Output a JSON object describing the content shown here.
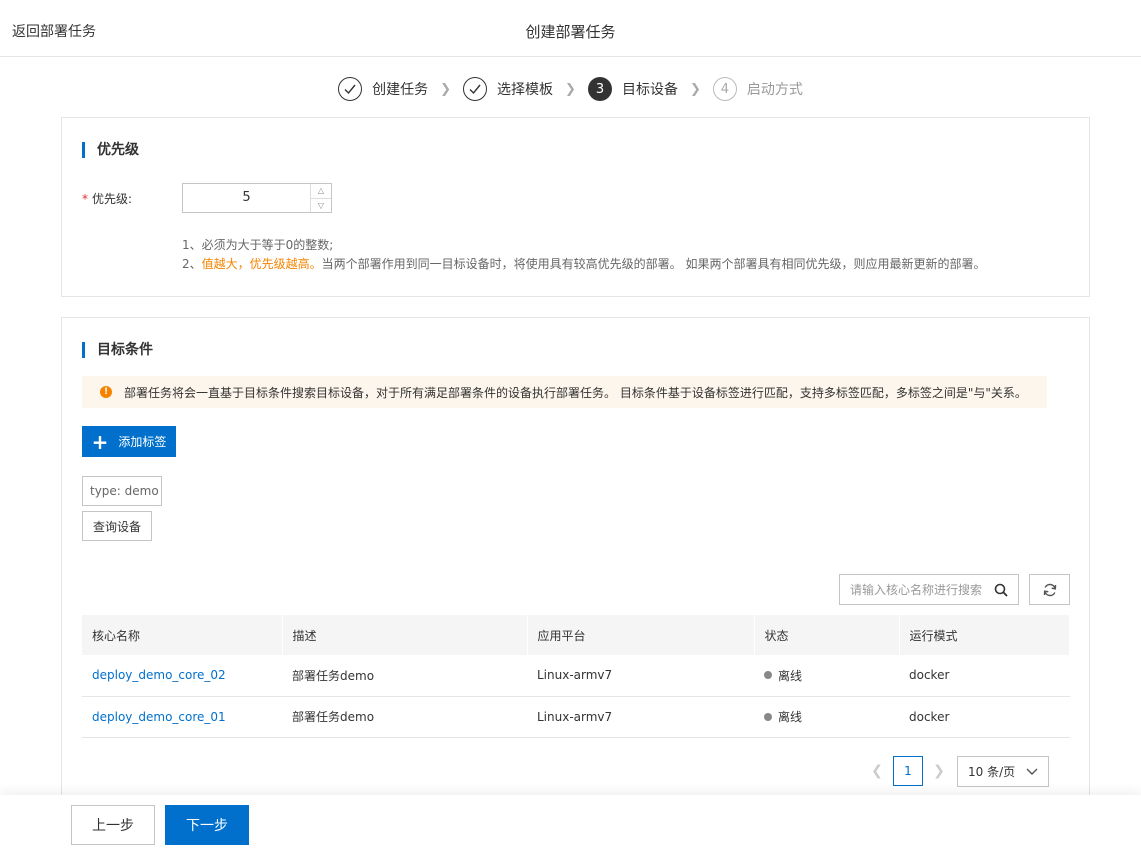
{
  "header": {
    "back_label": "返回部署任务",
    "title": "创建部署任务"
  },
  "steps": [
    {
      "label": "创建任务",
      "state": "done"
    },
    {
      "label": "选择模板",
      "state": "done"
    },
    {
      "label": "目标设备",
      "state": "active",
      "number": "3"
    },
    {
      "label": "启动方式",
      "state": "pending",
      "number": "4"
    }
  ],
  "priority": {
    "section_title": "优先级",
    "field_label": "优先级:",
    "required_mark": "*",
    "value": "5",
    "note1": "1、必须为大于等于0的整数;",
    "note2_prefix": "2、",
    "note2_highlight": "值越大，优先级越高。",
    "note2_rest": "当两个部署作用到同一目标设备时，将使用具有较高优先级的部署。 如果两个部署具有相同优先级，则应用最新更新的部署。"
  },
  "target": {
    "section_title": "目标条件",
    "alert_text": "部署任务将会一直基于目标条件搜索目标设备，对于所有满足部署条件的设备执行部署任务。 目标条件基于设备标签进行匹配，支持多标签匹配，多标签之间是\"与\"关系。",
    "add_tag_label": "添加标签",
    "tag_value": "type: demo",
    "query_label": "查询设备",
    "search_placeholder": "请输入核心名称进行搜索",
    "columns": [
      "核心名称",
      "描述",
      "应用平台",
      "状态",
      "运行模式"
    ],
    "rows": [
      {
        "name": "deploy_demo_core_02",
        "desc": "部署任务demo",
        "platform": "Linux-armv7",
        "status": "离线",
        "mode": "docker"
      },
      {
        "name": "deploy_demo_core_01",
        "desc": "部署任务demo",
        "platform": "Linux-armv7",
        "status": "离线",
        "mode": "docker"
      }
    ],
    "pagination": {
      "current_page": "1",
      "page_size": "10 条/页"
    }
  },
  "footer": {
    "prev_label": "上一步",
    "next_label": "下一步"
  },
  "colors": {
    "accent": "#0070cc",
    "warning": "#f68300",
    "required": "#e62e2e"
  }
}
